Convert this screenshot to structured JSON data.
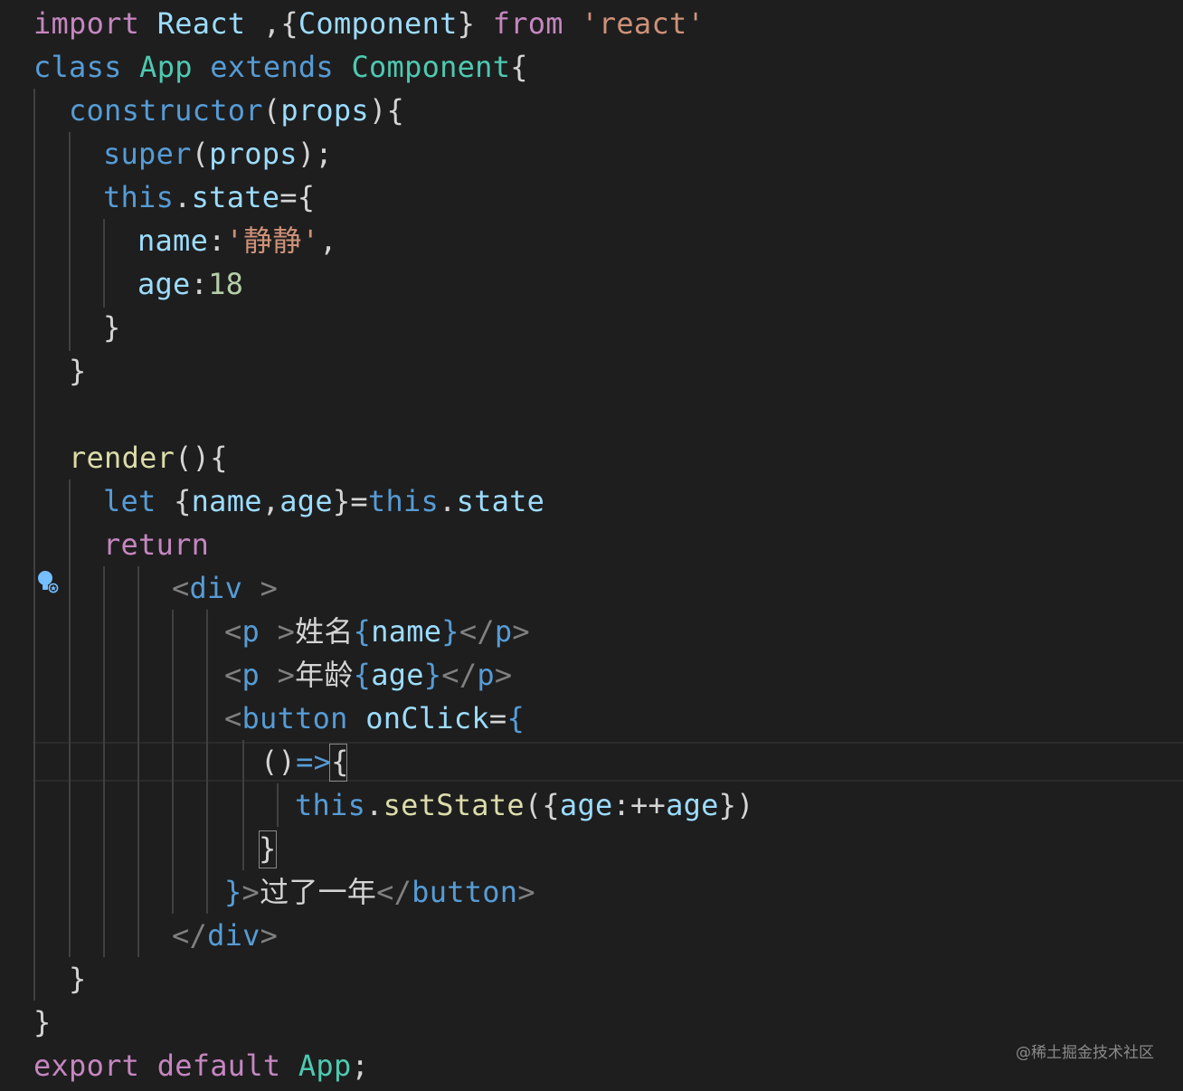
{
  "editor": {
    "theme": {
      "background": "#1e1e1e",
      "control_keyword": "#c586c0",
      "keyword": "#569cd6",
      "type": "#4ec9b0",
      "variable": "#9cdcfe",
      "function": "#dcdcaa",
      "string": "#ce9178",
      "number": "#b5cea8",
      "tag_punctuation": "#808080"
    },
    "gutter_icon": "lightbulb-autofix-icon",
    "lines": [
      [
        [
          "ctrl",
          "import"
        ],
        [
          "punc",
          " "
        ],
        [
          "var",
          "React"
        ],
        [
          "punc",
          " ,{"
        ],
        [
          "var",
          "Component"
        ],
        [
          "punc",
          "} "
        ],
        [
          "ctrl",
          "from"
        ],
        [
          "punc",
          " "
        ],
        [
          "str",
          "'react'"
        ]
      ],
      [
        [
          "kw",
          "class"
        ],
        [
          "punc",
          " "
        ],
        [
          "type",
          "App"
        ],
        [
          "punc",
          " "
        ],
        [
          "kw",
          "extends"
        ],
        [
          "punc",
          " "
        ],
        [
          "type",
          "Component"
        ],
        [
          "punc",
          "{"
        ]
      ],
      [
        [
          "kw",
          "constructor"
        ],
        [
          "punc",
          "("
        ],
        [
          "var",
          "props"
        ],
        [
          "punc",
          "){"
        ]
      ],
      [
        [
          "kw",
          "super"
        ],
        [
          "punc",
          "("
        ],
        [
          "var",
          "props"
        ],
        [
          "punc",
          ");"
        ]
      ],
      [
        [
          "kw",
          "this"
        ],
        [
          "punc",
          "."
        ],
        [
          "var",
          "state"
        ],
        [
          "punc",
          "={"
        ]
      ],
      [
        [
          "var",
          "name"
        ],
        [
          "punc",
          ":"
        ],
        [
          "str",
          "'静静'"
        ],
        [
          "punc",
          ","
        ]
      ],
      [
        [
          "var",
          "age"
        ],
        [
          "punc",
          ":"
        ],
        [
          "num",
          "18"
        ]
      ],
      [
        [
          "punc",
          "}"
        ]
      ],
      [
        [
          "punc",
          "}"
        ]
      ],
      [],
      [
        [
          "fn",
          "render"
        ],
        [
          "punc",
          "(){"
        ]
      ],
      [
        [
          "kw",
          "let"
        ],
        [
          "punc",
          " {"
        ],
        [
          "var",
          "name"
        ],
        [
          "punc",
          ","
        ],
        [
          "var",
          "age"
        ],
        [
          "punc",
          "}="
        ],
        [
          "kw",
          "this"
        ],
        [
          "punc",
          "."
        ],
        [
          "var",
          "state"
        ]
      ],
      [
        [
          "ctrl",
          "return"
        ]
      ],
      [
        [
          "tagp",
          "<"
        ],
        [
          "tag",
          "div"
        ],
        [
          "punc",
          " "
        ],
        [
          "tagp",
          ">"
        ]
      ],
      [
        [
          "tagp",
          "<"
        ],
        [
          "tag",
          "p"
        ],
        [
          "punc",
          " "
        ],
        [
          "tagp",
          ">"
        ],
        [
          "jsx",
          "姓名"
        ],
        [
          "kw",
          "{"
        ],
        [
          "var",
          "name"
        ],
        [
          "kw",
          "}"
        ],
        [
          "tagp",
          "</"
        ],
        [
          "tag",
          "p"
        ],
        [
          "tagp",
          ">"
        ]
      ],
      [
        [
          "tagp",
          "<"
        ],
        [
          "tag",
          "p"
        ],
        [
          "punc",
          " "
        ],
        [
          "tagp",
          ">"
        ],
        [
          "jsx",
          "年龄"
        ],
        [
          "kw",
          "{"
        ],
        [
          "var",
          "age"
        ],
        [
          "kw",
          "}"
        ],
        [
          "tagp",
          "</"
        ],
        [
          "tag",
          "p"
        ],
        [
          "tagp",
          ">"
        ]
      ],
      [
        [
          "tagp",
          "<"
        ],
        [
          "tag",
          "button"
        ],
        [
          "punc",
          " "
        ],
        [
          "var",
          "onClick"
        ],
        [
          "punc",
          "="
        ],
        [
          "kw",
          "{"
        ]
      ],
      [
        [
          "punc",
          "()"
        ],
        [
          "kw",
          "=>"
        ],
        [
          "punc",
          "{"
        ]
      ],
      [
        [
          "kw",
          "this"
        ],
        [
          "punc",
          "."
        ],
        [
          "fn",
          "setState"
        ],
        [
          "punc",
          "({"
        ],
        [
          "var",
          "age"
        ],
        [
          "punc",
          ":++"
        ],
        [
          "var",
          "age"
        ],
        [
          "punc",
          "})"
        ]
      ],
      [
        [
          "punc",
          "}"
        ]
      ],
      [
        [
          "kw",
          "}"
        ],
        [
          "tagp",
          ">"
        ],
        [
          "jsx",
          "过了一年"
        ],
        [
          "tagp",
          "</"
        ],
        [
          "tag",
          "button"
        ],
        [
          "tagp",
          ">"
        ]
      ],
      [
        [
          "tagp",
          "</"
        ],
        [
          "tag",
          "div"
        ],
        [
          "tagp",
          ">"
        ]
      ],
      [
        [
          "punc",
          "}"
        ]
      ],
      [
        [
          "punc",
          "}"
        ]
      ],
      [
        [
          "ctrl",
          "export"
        ],
        [
          "punc",
          " "
        ],
        [
          "ctrl",
          "default"
        ],
        [
          "punc",
          " "
        ],
        [
          "type",
          "App"
        ],
        [
          "punc",
          ";"
        ]
      ]
    ]
  },
  "watermark": "@稀土掘金技术社区"
}
